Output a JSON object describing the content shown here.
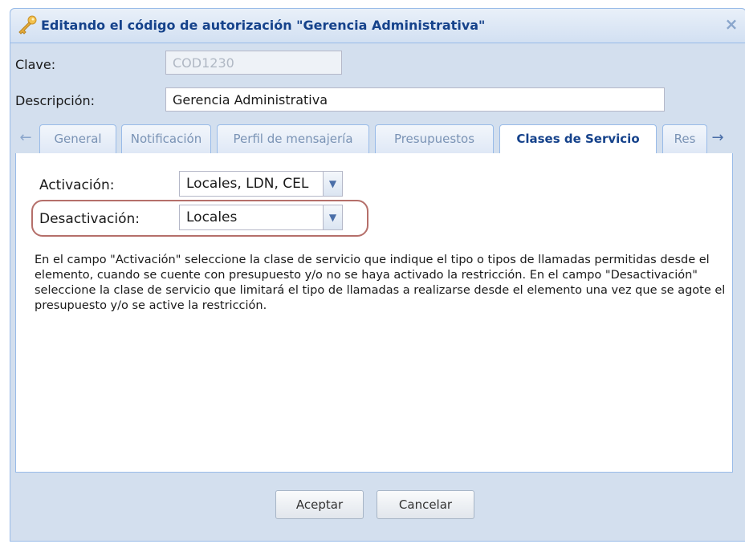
{
  "dialog": {
    "title": "Editando el código de autorización \"Gerencia Administrativa\"",
    "title_icon": "key-icon",
    "close_glyph": "×"
  },
  "form": {
    "clave_label": "Clave:",
    "clave_value": "COD1230",
    "descripcion_label": "Descripción:",
    "descripcion_value": "Gerencia Administrativa"
  },
  "tabs": [
    {
      "label": "General",
      "active": false
    },
    {
      "label": "Notificación",
      "active": false
    },
    {
      "label": "Perfil de mensajería",
      "active": false
    },
    {
      "label": "Presupuestos",
      "active": false
    },
    {
      "label": "Clases de Servicio",
      "active": true
    },
    {
      "label": "Res",
      "active": false
    }
  ],
  "tab_scroll": {
    "left": "←",
    "right": "→"
  },
  "panel": {
    "activacion_label": "Activación:",
    "activacion_value": "Locales, LDN, CEL",
    "desactivacion_label": "Desactivación:",
    "desactivacion_value": "Locales",
    "help_text": "En el campo \"Activación\" seleccione la clase de servicio que indique el tipo o tipos de llamadas permitidas desde el elemento, cuando se cuente con presupuesto y/o no se haya activado la restricción. En el campo \"Desactivación\" seleccione la clase de servicio que limitará el tipo de llamadas a realizarse desde el elemento una vez que se agote el presupuesto y/o se active la restricción."
  },
  "buttons": {
    "accept": "Aceptar",
    "cancel": "Cancelar"
  },
  "colors": {
    "title_text": "#15428b",
    "highlight_outline": "#b56f6a",
    "frame_border": "#99bbe8"
  }
}
